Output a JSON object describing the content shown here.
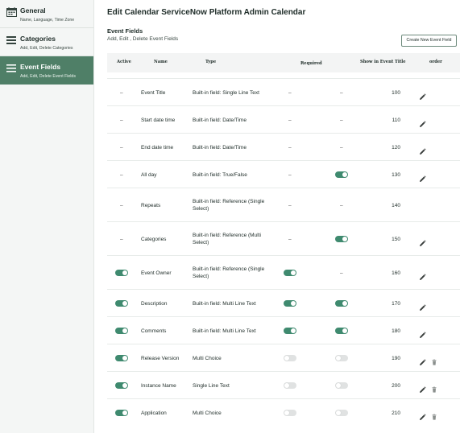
{
  "sidebar": {
    "items": [
      {
        "title": "General",
        "subtitle": "Name, Language, Time Zone",
        "icon": "calendar-icon",
        "active": false
      },
      {
        "title": "Categories",
        "subtitle": "Add, Edit, Delete Categories",
        "icon": "categories-icon",
        "active": false
      },
      {
        "title": "Event Fields",
        "subtitle": "Add, Edit, Delete Event Fields",
        "icon": "list-icon",
        "active": true
      }
    ]
  },
  "header": {
    "title": "Edit Calendar ServiceNow Platform Admin Calendar",
    "section_title": "Event Fields",
    "section_subtitle": "Add, Edit , Delete Event Fields",
    "create_button": "Create New Event Field"
  },
  "table": {
    "columns": [
      "Active",
      "Name",
      "Type",
      "Required",
      "Show in Event Title",
      "order"
    ],
    "rows": [
      {
        "active": "-",
        "name": "Event Title",
        "type": "Built-in field: Single Line Text",
        "required": "-",
        "show_in_title": "-",
        "order": "100",
        "edit": true,
        "delete": false
      },
      {
        "active": "-",
        "name": "Start date time",
        "type": "Built-in field: Date/Time",
        "required": "-",
        "show_in_title": "-",
        "order": "110",
        "edit": true,
        "delete": false
      },
      {
        "active": "-",
        "name": "End date time",
        "type": "Built-in field: Date/Time",
        "required": "-",
        "show_in_title": "-",
        "order": "120",
        "edit": true,
        "delete": false
      },
      {
        "active": "-",
        "name": "All day",
        "type": "Built-in field: True/False",
        "required": "-",
        "show_in_title": "on",
        "order": "130",
        "edit": true,
        "delete": false
      },
      {
        "active": "-",
        "name": "Repeats",
        "type": "Built-in field: Reference (Single Select)",
        "required": "-",
        "show_in_title": "-",
        "order": "140",
        "edit": false,
        "delete": false
      },
      {
        "active": "-",
        "name": "Categories",
        "type": "Built-in field: Reference (Multi Select)",
        "required": "-",
        "show_in_title": "on",
        "order": "150",
        "edit": true,
        "delete": false
      },
      {
        "active": "on",
        "name": "Event Owner",
        "type": "Built-in field: Reference (Single Select)",
        "required": "on",
        "show_in_title": "-",
        "order": "160",
        "edit": true,
        "delete": false
      },
      {
        "active": "on",
        "name": "Description",
        "type": "Built-in field: Multi Line Text",
        "required": "on",
        "show_in_title": "on",
        "order": "170",
        "edit": true,
        "delete": false
      },
      {
        "active": "on",
        "name": "Comments",
        "type": "Built-in field: Multi Line Text",
        "required": "on",
        "show_in_title": "on",
        "order": "180",
        "edit": true,
        "delete": false
      },
      {
        "active": "on",
        "name": "Release Version",
        "type": "Multi Choice",
        "required": "off",
        "show_in_title": "off",
        "order": "190",
        "edit": true,
        "delete": true
      },
      {
        "active": "on",
        "name": "Instance Name",
        "type": "Single Line Text",
        "required": "off",
        "show_in_title": "off",
        "order": "200",
        "edit": true,
        "delete": true
      },
      {
        "active": "on",
        "name": "Application",
        "type": "Multi Choice",
        "required": "off",
        "show_in_title": "off",
        "order": "210",
        "edit": true,
        "delete": true
      }
    ]
  },
  "colors": {
    "sidebar_active": "#4f7f67",
    "toggle_on": "#3f8a6f",
    "toggle_off": "#e0e2e2"
  }
}
